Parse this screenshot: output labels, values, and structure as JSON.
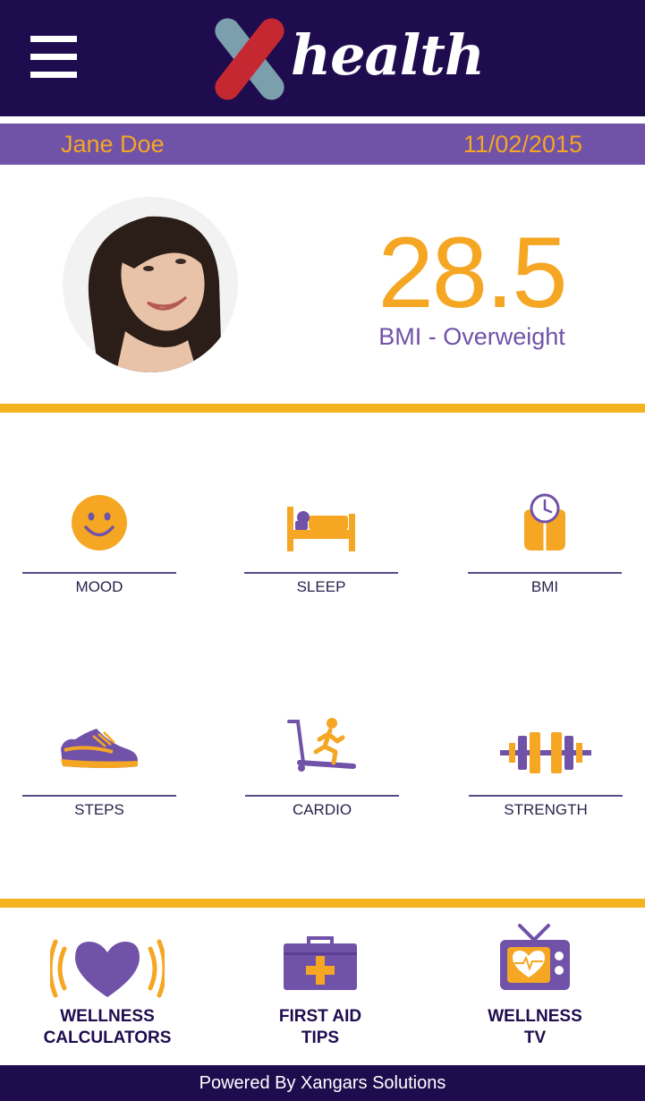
{
  "app": {
    "logo_text": "health",
    "logo_mark": "X"
  },
  "header": {
    "menu_icon": "hamburger-menu-icon"
  },
  "user": {
    "name": "Jane Doe",
    "date": "11/02/2015"
  },
  "bmi": {
    "value": "28.5",
    "label": "BMI - Overweight"
  },
  "tiles": [
    {
      "label": "MOOD",
      "icon": "smiley-icon"
    },
    {
      "label": "SLEEP",
      "icon": "bed-icon"
    },
    {
      "label": "BMI",
      "icon": "scale-icon"
    },
    {
      "label": "STEPS",
      "icon": "shoe-icon"
    },
    {
      "label": "CARDIO",
      "icon": "treadmill-icon"
    },
    {
      "label": "STRENGTH",
      "icon": "dumbbell-icon"
    }
  ],
  "quick_links": [
    {
      "line1": "WELLNESS",
      "line2": "CALCULATORS",
      "icon": "heart-icon"
    },
    {
      "line1": "FIRST AID",
      "line2": "TIPS",
      "icon": "first-aid-kit-icon"
    },
    {
      "line1": "WELLNESS",
      "line2": "TV",
      "icon": "tv-icon"
    }
  ],
  "footer": {
    "text": "Powered By Xangars Solutions"
  },
  "colors": {
    "primary": "#1e0c4e",
    "accent": "#f5a623",
    "purple": "#7052a8",
    "red": "#c62832",
    "grey_blue": "#7c9fae"
  }
}
